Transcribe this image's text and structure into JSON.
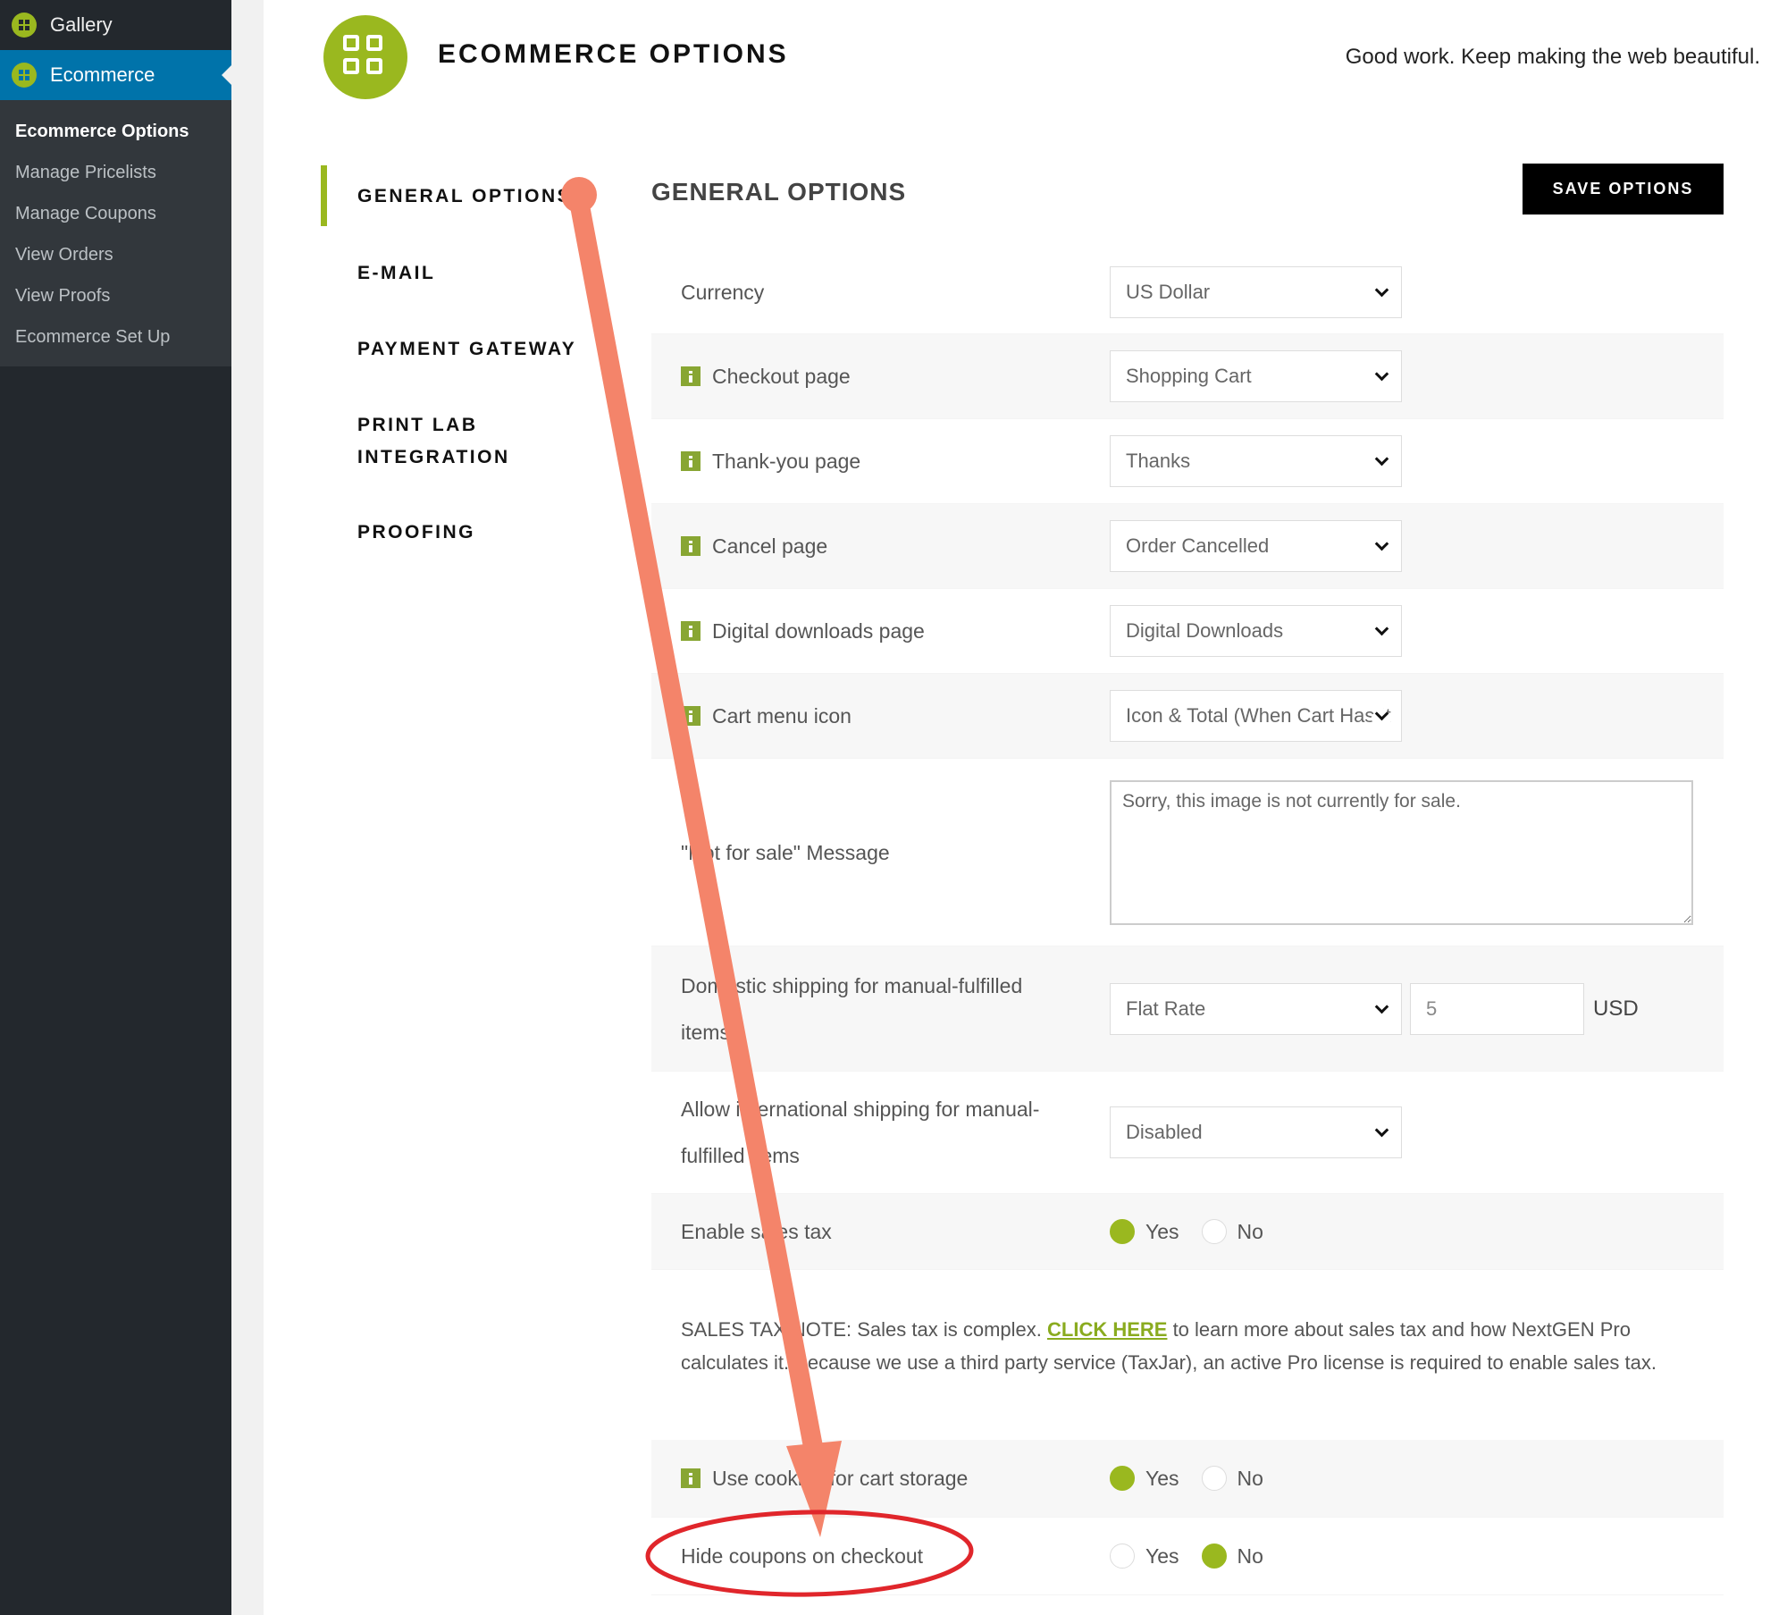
{
  "sidebar": {
    "menu": [
      {
        "label": "Gallery",
        "current": false
      },
      {
        "label": "Ecommerce",
        "current": true
      }
    ],
    "submenu": [
      {
        "label": "Ecommerce Options",
        "current": true
      },
      {
        "label": "Manage Pricelists",
        "current": false
      },
      {
        "label": "Manage Coupons",
        "current": false
      },
      {
        "label": "View Orders",
        "current": false
      },
      {
        "label": "View Proofs",
        "current": false
      },
      {
        "label": "Ecommerce Set Up",
        "current": false
      }
    ]
  },
  "header": {
    "title": "ECOMMERCE OPTIONS",
    "tagline": "Good work. Keep making the web beautiful."
  },
  "secondary_nav": {
    "items": [
      "GENERAL OPTIONS",
      "E-MAIL",
      "PAYMENT GATEWAY",
      "PRINT LAB",
      "INTEGRATION",
      "PROOFING"
    ]
  },
  "section": {
    "title": "GENERAL OPTIONS",
    "save_label": "SAVE OPTIONS"
  },
  "options": {
    "currency": {
      "label": "Currency",
      "value": "US Dollar"
    },
    "checkout": {
      "label": "Checkout page",
      "value": "Shopping Cart"
    },
    "thankyou": {
      "label": "Thank-you page",
      "value": "Thanks"
    },
    "cancel": {
      "label": "Cancel page",
      "value": "Order Cancelled"
    },
    "downloads": {
      "label": "Digital downloads page",
      "value": "Digital Downloads"
    },
    "cart_icon": {
      "label": "Cart menu icon",
      "value": "Icon & Total (When Cart Has It"
    },
    "not_for_sale": {
      "label": "\"Not for sale\" Message",
      "value": "Sorry, this image is not currently for sale."
    },
    "domestic_shipping": {
      "label": "Domestic shipping for manual-fulfilled items",
      "method": "Flat Rate",
      "amount": "5",
      "unit": "USD"
    },
    "intl_shipping": {
      "label": "Allow international shipping for manual-fulfilled items",
      "value": "Disabled"
    },
    "sales_tax": {
      "label": "Enable sales tax",
      "yes": "Yes",
      "no": "No",
      "selected": "Yes"
    },
    "tax_note": {
      "prefix": "SALES TAX NOTE: Sales tax is complex. ",
      "link": "CLICK HERE",
      "suffix": " to learn more about sales tax and how NextGEN Pro calculates it. Because we use a third party service (TaxJar), an active Pro license is required to enable sales tax."
    },
    "cookies": {
      "label": "Use cookies for cart storage",
      "yes": "Yes",
      "no": "No",
      "selected": "Yes"
    },
    "hide_coupons": {
      "label": "Hide coupons on checkout",
      "yes": "Yes",
      "no": "No",
      "selected": "No"
    }
  },
  "colors": {
    "accent": "#9ab81f",
    "annotation": "#f4846a",
    "circle": "#e0262b",
    "wp_sidebar": "#23282d",
    "wp_active": "#0073aa"
  }
}
